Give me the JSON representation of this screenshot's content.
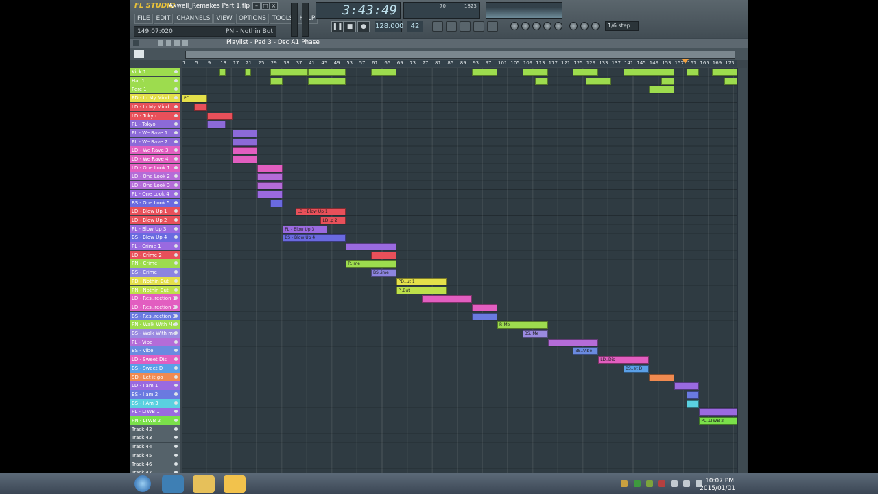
{
  "window": {
    "app": "FL STUDIO",
    "title": "Axwell_Remakes Part 1.flp"
  },
  "menu": [
    "FILE",
    "EDIT",
    "CHANNELS",
    "VIEW",
    "OPTIONS",
    "TOOLS",
    "HELP"
  ],
  "status": {
    "position": "149:07:020",
    "hint": "PN - Nothin But"
  },
  "transport": {
    "time": "3:43:49",
    "tempo": "128.000",
    "pattern": "42",
    "cpu": "70",
    "mem": "1823"
  },
  "snap": "1/6 step",
  "playlist": {
    "title": "Playlist - Pad 3 - Osc A1 Phase"
  },
  "ruler": [
    "1",
    "5",
    "9",
    "13",
    "17",
    "21",
    "25",
    "29",
    "33",
    "37",
    "41",
    "45",
    "49",
    "53",
    "57",
    "61",
    "65",
    "69",
    "73",
    "77",
    "81",
    "85",
    "89",
    "93",
    "97",
    "101",
    "105",
    "109",
    "113",
    "117",
    "121",
    "125",
    "129",
    "133",
    "137",
    "141",
    "145",
    "149",
    "153",
    "157",
    "161",
    "165",
    "169",
    "173"
  ],
  "tracks": [
    {
      "name": "Kick 1",
      "color": "#9ddc4e"
    },
    {
      "name": "Hat 1",
      "color": "#9ddc4e"
    },
    {
      "name": "Perc 1",
      "color": "#9ddc4e"
    },
    {
      "name": "PD - In My Mind",
      "color": "#e4e04a"
    },
    {
      "name": "LD - In My Mind",
      "color": "#e8505a"
    },
    {
      "name": "LD - Tokyo",
      "color": "#e8505a"
    },
    {
      "name": "PL - Tokyo",
      "color": "#8c6ad8"
    },
    {
      "name": "PL - We Rave 1",
      "color": "#8c6ad8"
    },
    {
      "name": "PL - We Rave 2",
      "color": "#8c6ad8"
    },
    {
      "name": "LD - We Rave 3",
      "color": "#e25ec0"
    },
    {
      "name": "LD - We Rave 4",
      "color": "#e25ec0"
    },
    {
      "name": "LD - One Look 1",
      "color": "#e25ec0"
    },
    {
      "name": "LD - One Look 2",
      "color": "#b46cd8"
    },
    {
      "name": "LD - One Look 3",
      "color": "#b46cd8"
    },
    {
      "name": "PL - One Look 4",
      "color": "#9a6ae0"
    },
    {
      "name": "BS - One Look 5",
      "color": "#6a6ae0"
    },
    {
      "name": "LD - Blow Up 1",
      "color": "#e8505a"
    },
    {
      "name": "LD - Blow Up 2",
      "color": "#e8505a"
    },
    {
      "name": "PL - Blow Up 3",
      "color": "#9a6ae0"
    },
    {
      "name": "BS - Blow Up 4",
      "color": "#6a6ae0"
    },
    {
      "name": "PL - Crime 1",
      "color": "#9a6ae0"
    },
    {
      "name": "LD - Crime 2",
      "color": "#e8505a"
    },
    {
      "name": "PN - Crime",
      "color": "#9ddc4e"
    },
    {
      "name": "BS - Crime",
      "color": "#8c84e0"
    },
    {
      "name": "PD - Nothin But",
      "color": "#e4e04a"
    },
    {
      "name": "PN - Nothin But",
      "color": "#bde04a"
    },
    {
      "name": "LD - Res..rection 1",
      "color": "#e25ec0"
    },
    {
      "name": "LD - Res..rection 2",
      "color": "#e25ec0"
    },
    {
      "name": "BS - Res..rection 3",
      "color": "#6a7ae0"
    },
    {
      "name": "PN - Walk With Me",
      "color": "#9ddc4e"
    },
    {
      "name": "BS - Walk With me",
      "color": "#9a8ae0"
    },
    {
      "name": "PL - Vibe",
      "color": "#b46cd8"
    },
    {
      "name": "BS - Vibe",
      "color": "#6a8ae0"
    },
    {
      "name": "LD - Sweet Dis",
      "color": "#e25ec0"
    },
    {
      "name": "BS - Sweet D",
      "color": "#5aa0e8"
    },
    {
      "name": "SD - Let it go",
      "color": "#f08a50"
    },
    {
      "name": "LD - I am 1",
      "color": "#9a6ae0"
    },
    {
      "name": "BS - I am 2",
      "color": "#6a7ae0"
    },
    {
      "name": "BS - I Am 3",
      "color": "#5ad0e0"
    },
    {
      "name": "PL - LTWB 1",
      "color": "#9a6ae0"
    },
    {
      "name": "PN - LTWB 2",
      "color": "#7ae04a"
    },
    {
      "name": "Track 42",
      "color": "#55626a"
    },
    {
      "name": "Track 43",
      "color": "#55626a"
    },
    {
      "name": "Track 44",
      "color": "#55626a"
    },
    {
      "name": "Track 45",
      "color": "#55626a"
    },
    {
      "name": "Track 46",
      "color": "#55626a"
    },
    {
      "name": "Track 47",
      "color": "#55626a"
    }
  ],
  "clips": [
    {
      "row": 0,
      "start": 13,
      "len": 2,
      "color": "#9ddc4e",
      "label": ""
    },
    {
      "row": 0,
      "start": 21,
      "len": 2,
      "color": "#9ddc4e",
      "label": ""
    },
    {
      "row": 0,
      "start": 29,
      "len": 12,
      "color": "#9ddc4e",
      "label": ""
    },
    {
      "row": 0,
      "start": 41,
      "len": 12,
      "color": "#9ddc4e",
      "label": ""
    },
    {
      "row": 0,
      "start": 61,
      "len": 8,
      "color": "#9ddc4e",
      "label": ""
    },
    {
      "row": 0,
      "start": 93,
      "len": 8,
      "color": "#9ddc4e",
      "label": ""
    },
    {
      "row": 0,
      "start": 109,
      "len": 8,
      "color": "#9ddc4e",
      "label": ""
    },
    {
      "row": 0,
      "start": 125,
      "len": 8,
      "color": "#9ddc4e",
      "label": ""
    },
    {
      "row": 0,
      "start": 141,
      "len": 16,
      "color": "#9ddc4e",
      "label": ""
    },
    {
      "row": 0,
      "start": 161,
      "len": 4,
      "color": "#9ddc4e",
      "label": ""
    },
    {
      "row": 0,
      "start": 169,
      "len": 8,
      "color": "#9ddc4e",
      "label": ""
    },
    {
      "row": 1,
      "start": 29,
      "len": 4,
      "color": "#9ddc4e",
      "label": ""
    },
    {
      "row": 1,
      "start": 41,
      "len": 12,
      "color": "#9ddc4e",
      "label": ""
    },
    {
      "row": 1,
      "start": 113,
      "len": 4,
      "color": "#9ddc4e",
      "label": ""
    },
    {
      "row": 1,
      "start": 129,
      "len": 8,
      "color": "#9ddc4e",
      "label": ""
    },
    {
      "row": 1,
      "start": 153,
      "len": 4,
      "color": "#9ddc4e",
      "label": ""
    },
    {
      "row": 1,
      "start": 173,
      "len": 4,
      "color": "#9ddc4e",
      "label": ""
    },
    {
      "row": 2,
      "start": 149,
      "len": 8,
      "color": "#9ddc4e",
      "label": ""
    },
    {
      "row": 3,
      "start": 1,
      "len": 8,
      "color": "#e4e04a",
      "label": "PD"
    },
    {
      "row": 4,
      "start": 5,
      "len": 4,
      "color": "#e8505a",
      "label": ""
    },
    {
      "row": 5,
      "start": 9,
      "len": 8,
      "color": "#e8505a",
      "label": ""
    },
    {
      "row": 6,
      "start": 9,
      "len": 6,
      "color": "#8c6ad8",
      "label": ""
    },
    {
      "row": 7,
      "start": 17,
      "len": 8,
      "color": "#8c6ad8",
      "label": ""
    },
    {
      "row": 8,
      "start": 17,
      "len": 8,
      "color": "#8c6ad8",
      "label": ""
    },
    {
      "row": 9,
      "start": 17,
      "len": 8,
      "color": "#e25ec0",
      "label": ""
    },
    {
      "row": 10,
      "start": 17,
      "len": 8,
      "color": "#e25ec0",
      "label": ""
    },
    {
      "row": 11,
      "start": 25,
      "len": 8,
      "color": "#e25ec0",
      "label": ""
    },
    {
      "row": 12,
      "start": 25,
      "len": 8,
      "color": "#b46cd8",
      "label": ""
    },
    {
      "row": 13,
      "start": 25,
      "len": 8,
      "color": "#b46cd8",
      "label": ""
    },
    {
      "row": 14,
      "start": 25,
      "len": 8,
      "color": "#9a6ae0",
      "label": ""
    },
    {
      "row": 15,
      "start": 29,
      "len": 4,
      "color": "#6a6ae0",
      "label": ""
    },
    {
      "row": 16,
      "start": 37,
      "len": 16,
      "color": "#e8505a",
      "label": "LD - Blow Up 1"
    },
    {
      "row": 17,
      "start": 45,
      "len": 8,
      "color": "#e8505a",
      "label": "LD..p 2"
    },
    {
      "row": 18,
      "start": 33,
      "len": 14,
      "color": "#9a6ae0",
      "label": "PL - Blow Up 3"
    },
    {
      "row": 19,
      "start": 33,
      "len": 20,
      "color": "#6a6ae0",
      "label": "BS - Blow Up 4"
    },
    {
      "row": 20,
      "start": 53,
      "len": 16,
      "color": "#9a6ae0",
      "label": ""
    },
    {
      "row": 21,
      "start": 61,
      "len": 8,
      "color": "#e8505a",
      "label": ""
    },
    {
      "row": 22,
      "start": 53,
      "len": 16,
      "color": "#9ddc4e",
      "label": "P..ime"
    },
    {
      "row": 23,
      "start": 61,
      "len": 8,
      "color": "#8c84e0",
      "label": "BS..ime"
    },
    {
      "row": 24,
      "start": 69,
      "len": 16,
      "color": "#e4e04a",
      "label": "PD..ut 1"
    },
    {
      "row": 25,
      "start": 69,
      "len": 16,
      "color": "#bde04a",
      "label": "P..But"
    },
    {
      "row": 26,
      "start": 77,
      "len": 16,
      "color": "#e25ec0",
      "label": ""
    },
    {
      "row": 27,
      "start": 93,
      "len": 8,
      "color": "#e25ec0",
      "label": ""
    },
    {
      "row": 28,
      "start": 93,
      "len": 8,
      "color": "#6a7ae0",
      "label": ""
    },
    {
      "row": 29,
      "start": 101,
      "len": 16,
      "color": "#9ddc4e",
      "label": "P..Me"
    },
    {
      "row": 30,
      "start": 109,
      "len": 8,
      "color": "#9a8ae0",
      "label": "BS..Me"
    },
    {
      "row": 31,
      "start": 117,
      "len": 16,
      "color": "#b46cd8",
      "label": ""
    },
    {
      "row": 32,
      "start": 125,
      "len": 8,
      "color": "#6a8ae0",
      "label": "BS..Vibe"
    },
    {
      "row": 33,
      "start": 133,
      "len": 16,
      "color": "#e25ec0",
      "label": "LD..Dis"
    },
    {
      "row": 34,
      "start": 141,
      "len": 8,
      "color": "#5aa0e8",
      "label": "BS..et D"
    },
    {
      "row": 35,
      "start": 149,
      "len": 8,
      "color": "#f08a50",
      "label": ""
    },
    {
      "row": 36,
      "start": 157,
      "len": 8,
      "color": "#9a6ae0",
      "label": ""
    },
    {
      "row": 37,
      "start": 161,
      "len": 4,
      "color": "#6a7ae0",
      "label": ""
    },
    {
      "row": 38,
      "start": 161,
      "len": 4,
      "color": "#5ad0e0",
      "label": ""
    },
    {
      "row": 39,
      "start": 165,
      "len": 12,
      "color": "#9a6ae0",
      "label": ""
    },
    {
      "row": 40,
      "start": 165,
      "len": 12,
      "color": "#7ae04a",
      "label": "PL..LTWB 2"
    }
  ],
  "taskbar": {
    "time": "10:07 PM",
    "date": "2015/01/01"
  }
}
